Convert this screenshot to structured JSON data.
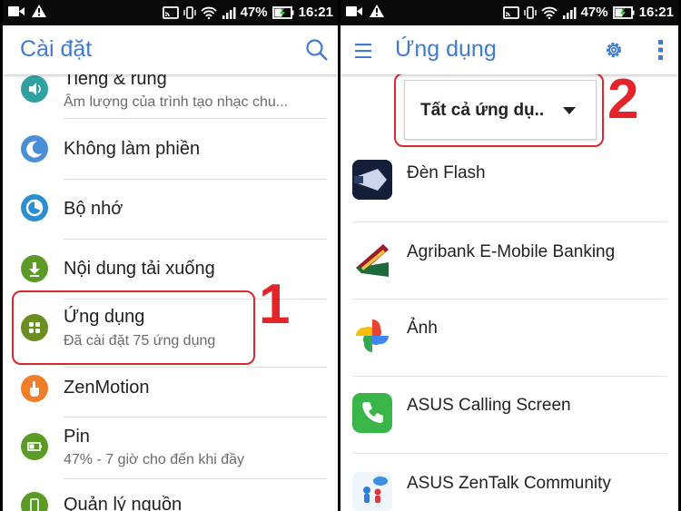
{
  "status_bar": {
    "battery": "47%",
    "time": "16:21"
  },
  "settings_screen": {
    "title": "Cài đặt",
    "items": [
      {
        "title": "Tiếng & rung",
        "subtitle": "Âm lượng của trình tạo nhạc chu...",
        "icon": "volume-icon",
        "color": "#2fa1a0"
      },
      {
        "title": "Không làm phiền",
        "subtitle": "",
        "icon": "moon-icon",
        "color": "#4a8fd6"
      },
      {
        "title": "Bộ nhớ",
        "subtitle": "",
        "icon": "storage-icon",
        "color": "#2a8fd0"
      },
      {
        "title": "Nội dung tải xuống",
        "subtitle": "",
        "icon": "download-icon",
        "color": "#5c9a28"
      },
      {
        "title": "Ứng dụng",
        "subtitle": "Đã cài đặt 75 ứng dụng",
        "icon": "apps-icon",
        "color": "#6a8e1f"
      },
      {
        "title": "ZenMotion",
        "subtitle": "",
        "icon": "hand-icon",
        "color": "#ef7d2a"
      },
      {
        "title": "Pin",
        "subtitle": "47% - 7 giờ cho đến khi đầy",
        "icon": "battery-icon",
        "color": "#5a9a25"
      },
      {
        "title": "Quản lý nguồn",
        "subtitle": "",
        "icon": "power-manage-icon",
        "color": "#5a9a25"
      }
    ],
    "annotation": "1"
  },
  "apps_screen": {
    "title": "Ứng dụng",
    "filter_label": "Tất cả ứng dụ..",
    "annotation": "2",
    "apps": [
      {
        "name": "Đèn Flash",
        "icon": "flashlight-icon"
      },
      {
        "name": "Agribank E-Mobile Banking",
        "icon": "agribank-icon"
      },
      {
        "name": "Ảnh",
        "icon": "photos-icon"
      },
      {
        "name": "ASUS Calling Screen",
        "icon": "phone-icon"
      },
      {
        "name": "ASUS ZenTalk Community",
        "icon": "zentalk-icon"
      }
    ]
  },
  "colors": {
    "accent": "#3e7bd1",
    "highlight": "#d9282f"
  }
}
